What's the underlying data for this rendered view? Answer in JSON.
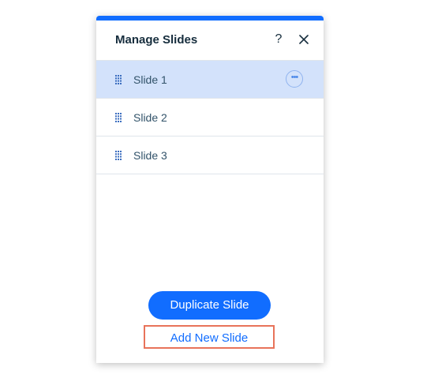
{
  "panel": {
    "title": "Manage Slides",
    "help_label": "?",
    "accent_color": "#116dff"
  },
  "icons": {
    "help": "question-mark-icon",
    "close": "close-icon",
    "drag": "drag-handle-icon",
    "more": "more-actions-icon"
  },
  "slides": [
    {
      "label": "Slide 1",
      "selected": true
    },
    {
      "label": "Slide 2",
      "selected": false
    },
    {
      "label": "Slide 3",
      "selected": false
    }
  ],
  "actions": {
    "duplicate_label": "Duplicate Slide",
    "add_label": "Add New Slide"
  }
}
